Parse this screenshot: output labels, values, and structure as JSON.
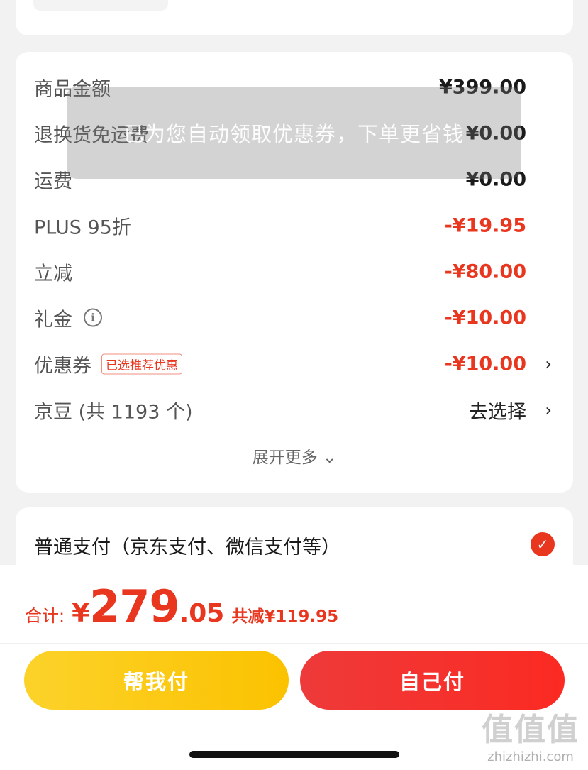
{
  "fees": [
    {
      "label": "商品金额",
      "value": "¥399.00"
    },
    {
      "label": "退换货免运费",
      "value": "¥0.00"
    },
    {
      "label": "运费",
      "value": "¥0.00"
    },
    {
      "label": "PLUS 95折",
      "value": "-¥19.95"
    },
    {
      "label": "立减",
      "value": "-¥80.00"
    },
    {
      "label": "礼金",
      "value": "-¥10.00"
    },
    {
      "label": "优惠券",
      "tag": "已选推荐优惠",
      "value": "-¥10.00"
    },
    {
      "label": "京豆 (共 1193 个)",
      "value": "去选择"
    }
  ],
  "expand_label": "展开更多 ⌄",
  "toast": "已为您自动领取优惠券，下单更省钱",
  "payment": {
    "label": "普通支付（京东支付、微信支付等）"
  },
  "total": {
    "label": "合计:",
    "currency": "¥",
    "integer": "279",
    "decimal": ".05",
    "saved": "共减¥119.95"
  },
  "buttons": {
    "help": "帮我付",
    "self": "自己付"
  },
  "watermark": {
    "logo": "值值值",
    "text": "zhizhizhi.com"
  },
  "colors": {
    "accent_red": "#e8361f",
    "help_yellow": "#fbc200",
    "self_red": "#f52e2a"
  }
}
